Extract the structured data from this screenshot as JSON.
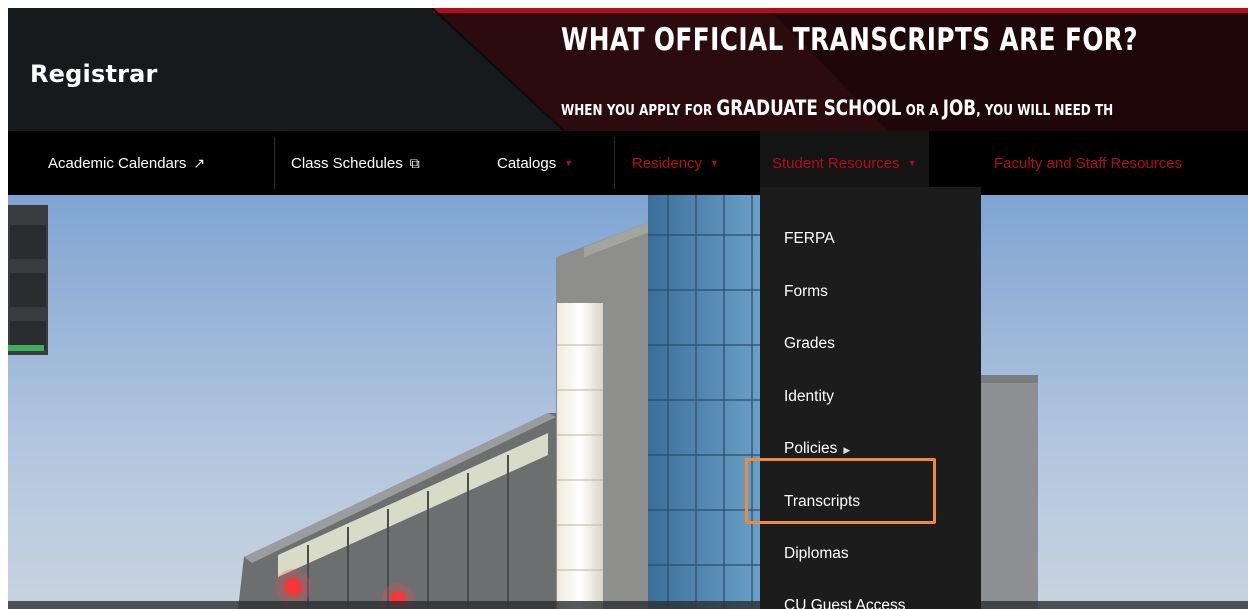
{
  "header": {
    "site_title": "Registrar",
    "headline": "WHAT OFFICIAL TRANSCRIPTS ARE FOR?",
    "subline": {
      "part1": "WHEN YOU APPLY FOR ",
      "part2": "GRADUATE SCHOOL",
      "part3": " OR A ",
      "part4": "JOB",
      "part5": ", YOU WILL NEED TH"
    }
  },
  "nav": {
    "items": [
      {
        "label": "Academic Calendars",
        "icon": "external-link-icon"
      },
      {
        "label": "Class Schedules",
        "icon": "external-link-icon"
      },
      {
        "label": "Catalogs",
        "icon": "caret-down-icon"
      },
      {
        "label": "Residency",
        "icon": "caret-down-icon"
      },
      {
        "label": "Student Resources",
        "icon": "caret-down-icon"
      },
      {
        "label": "Faculty and Staff Resources"
      }
    ]
  },
  "dropdown": {
    "items": [
      {
        "label": "FERPA"
      },
      {
        "label": "Forms"
      },
      {
        "label": "Grades"
      },
      {
        "label": "Identity"
      },
      {
        "label": "Policies",
        "icon": "caret-right-icon"
      },
      {
        "label": "Transcripts",
        "highlighted": true
      },
      {
        "label": "Diplomas"
      },
      {
        "label": "CU Guest Access"
      }
    ]
  },
  "colors": {
    "accent_red": "#b20d1b",
    "highlight_orange": "#ee8a39",
    "nav_bg": "#000000",
    "header_bg": "#161a1d"
  }
}
